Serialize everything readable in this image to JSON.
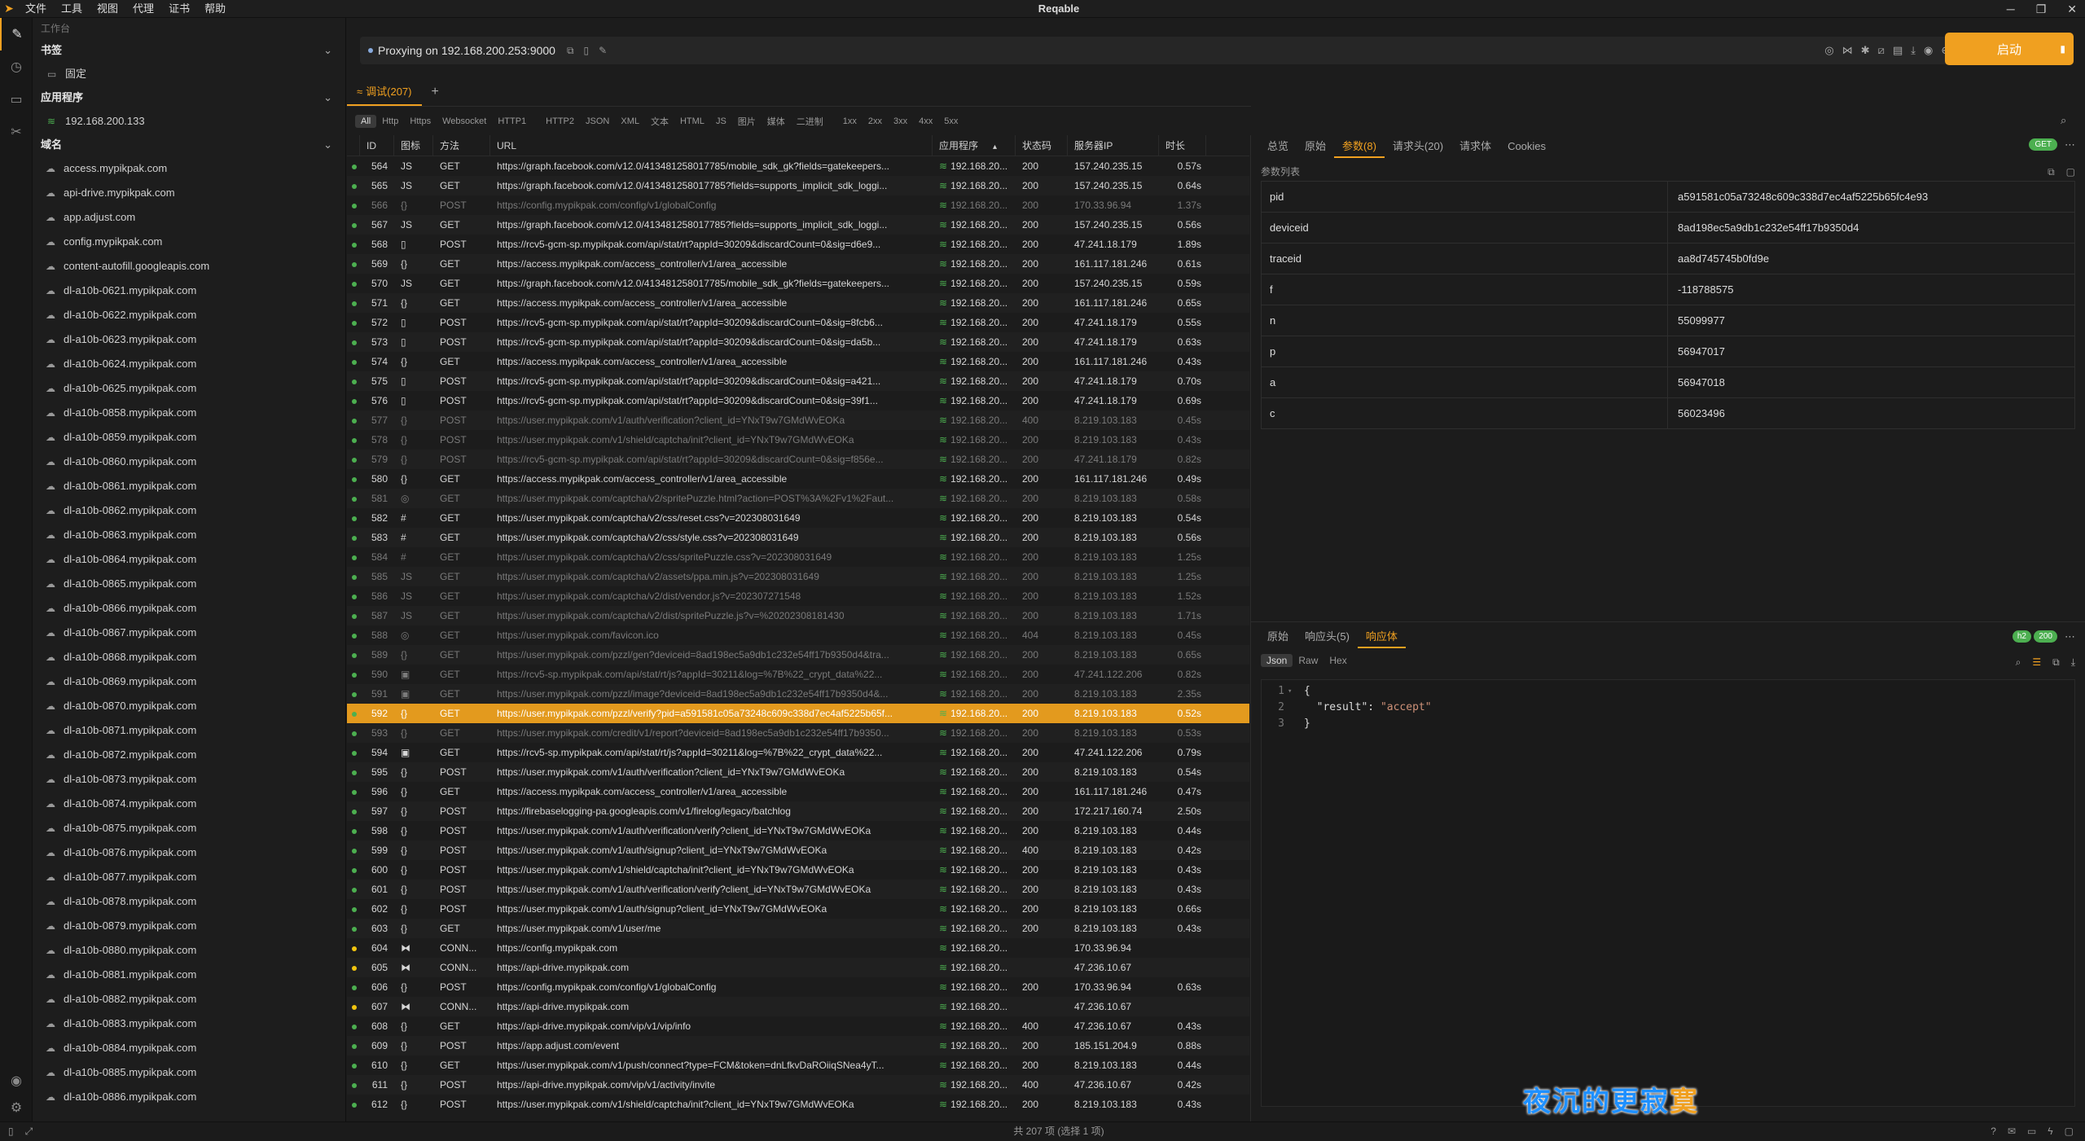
{
  "window": {
    "title": "Reqable",
    "menus": [
      "文件",
      "工具",
      "视图",
      "代理",
      "证书",
      "帮助"
    ]
  },
  "sidebar": {
    "header": "工作台",
    "bookmarks_label": "书签",
    "bookmarks": [
      {
        "label": "固定"
      }
    ],
    "apps_label": "应用程序",
    "apps": [
      {
        "label": "192.168.200.133"
      }
    ],
    "domains_label": "域名",
    "domains": [
      "access.mypikpak.com",
      "api-drive.mypikpak.com",
      "app.adjust.com",
      "config.mypikpak.com",
      "content-autofill.googleapis.com",
      "dl-a10b-0621.mypikpak.com",
      "dl-a10b-0622.mypikpak.com",
      "dl-a10b-0623.mypikpak.com",
      "dl-a10b-0624.mypikpak.com",
      "dl-a10b-0625.mypikpak.com",
      "dl-a10b-0858.mypikpak.com",
      "dl-a10b-0859.mypikpak.com",
      "dl-a10b-0860.mypikpak.com",
      "dl-a10b-0861.mypikpak.com",
      "dl-a10b-0862.mypikpak.com",
      "dl-a10b-0863.mypikpak.com",
      "dl-a10b-0864.mypikpak.com",
      "dl-a10b-0865.mypikpak.com",
      "dl-a10b-0866.mypikpak.com",
      "dl-a10b-0867.mypikpak.com",
      "dl-a10b-0868.mypikpak.com",
      "dl-a10b-0869.mypikpak.com",
      "dl-a10b-0870.mypikpak.com",
      "dl-a10b-0871.mypikpak.com",
      "dl-a10b-0872.mypikpak.com",
      "dl-a10b-0873.mypikpak.com",
      "dl-a10b-0874.mypikpak.com",
      "dl-a10b-0875.mypikpak.com",
      "dl-a10b-0876.mypikpak.com",
      "dl-a10b-0877.mypikpak.com",
      "dl-a10b-0878.mypikpak.com",
      "dl-a10b-0879.mypikpak.com",
      "dl-a10b-0880.mypikpak.com",
      "dl-a10b-0881.mypikpak.com",
      "dl-a10b-0882.mypikpak.com",
      "dl-a10b-0883.mypikpak.com",
      "dl-a10b-0884.mypikpak.com",
      "dl-a10b-0885.mypikpak.com",
      "dl-a10b-0886.mypikpak.com"
    ]
  },
  "proxy": {
    "text": "Proxying on 192.168.200.253:9000",
    "start_label": "启动"
  },
  "tabs": {
    "debug_label": "调试(207)",
    "add_label": "+"
  },
  "filters": [
    "All",
    "Http",
    "Https",
    "Websocket",
    "HTTP1",
    "HTTP2",
    "JSON",
    "XML",
    "文本",
    "HTML",
    "JS",
    "图片",
    "媒体",
    "二进制",
    "1xx",
    "2xx",
    "3xx",
    "4xx",
    "5xx"
  ],
  "table": {
    "headers": {
      "id": "ID",
      "icon": "图标",
      "method": "方法",
      "url": "URL",
      "app": "应用程序",
      "status": "状态码",
      "ip": "服务器IP",
      "duration": "时长"
    },
    "rows": [
      {
        "id": "564",
        "icon": "JS",
        "method": "GET",
        "url": "https://graph.facebook.com/v12.0/413481258017785/mobile_sdk_gk?fields=gatekeepers...",
        "app": "192.168.20...",
        "status": "200",
        "ip": "157.240.235.15",
        "dur": "0.57s",
        "dot": "green",
        "dim": false
      },
      {
        "id": "565",
        "icon": "JS",
        "method": "GET",
        "url": "https://graph.facebook.com/v12.0/413481258017785?fields=supports_implicit_sdk_loggi...",
        "app": "192.168.20...",
        "status": "200",
        "ip": "157.240.235.15",
        "dur": "0.64s",
        "dot": "green",
        "dim": false
      },
      {
        "id": "566",
        "icon": "{}",
        "method": "POST",
        "url": "https://config.mypikpak.com/config/v1/globalConfig",
        "app": "192.168.20...",
        "status": "200",
        "ip": "170.33.96.94",
        "dur": "1.37s",
        "dot": "green",
        "dim": true
      },
      {
        "id": "567",
        "icon": "JS",
        "method": "GET",
        "url": "https://graph.facebook.com/v12.0/413481258017785?fields=supports_implicit_sdk_loggi...",
        "app": "192.168.20...",
        "status": "200",
        "ip": "157.240.235.15",
        "dur": "0.56s",
        "dot": "green",
        "dim": false
      },
      {
        "id": "568",
        "icon": "▯",
        "method": "POST",
        "url": "https://rcv5-gcm-sp.mypikpak.com/api/stat/rt?appId=30209&discardCount=0&sig=d6e9...",
        "app": "192.168.20...",
        "status": "200",
        "ip": "47.241.18.179",
        "dur": "1.89s",
        "dot": "green",
        "dim": false
      },
      {
        "id": "569",
        "icon": "{}",
        "method": "GET",
        "url": "https://access.mypikpak.com/access_controller/v1/area_accessible",
        "app": "192.168.20...",
        "status": "200",
        "ip": "161.117.181.246",
        "dur": "0.61s",
        "dot": "green",
        "dim": false
      },
      {
        "id": "570",
        "icon": "JS",
        "method": "GET",
        "url": "https://graph.facebook.com/v12.0/413481258017785/mobile_sdk_gk?fields=gatekeepers...",
        "app": "192.168.20...",
        "status": "200",
        "ip": "157.240.235.15",
        "dur": "0.59s",
        "dot": "green",
        "dim": false
      },
      {
        "id": "571",
        "icon": "{}",
        "method": "GET",
        "url": "https://access.mypikpak.com/access_controller/v1/area_accessible",
        "app": "192.168.20...",
        "status": "200",
        "ip": "161.117.181.246",
        "dur": "0.65s",
        "dot": "green",
        "dim": false
      },
      {
        "id": "572",
        "icon": "▯",
        "method": "POST",
        "url": "https://rcv5-gcm-sp.mypikpak.com/api/stat/rt?appId=30209&discardCount=0&sig=8fcb6...",
        "app": "192.168.20...",
        "status": "200",
        "ip": "47.241.18.179",
        "dur": "0.55s",
        "dot": "green",
        "dim": false
      },
      {
        "id": "573",
        "icon": "▯",
        "method": "POST",
        "url": "https://rcv5-gcm-sp.mypikpak.com/api/stat/rt?appId=30209&discardCount=0&sig=da5b...",
        "app": "192.168.20...",
        "status": "200",
        "ip": "47.241.18.179",
        "dur": "0.63s",
        "dot": "green",
        "dim": false
      },
      {
        "id": "574",
        "icon": "{}",
        "method": "GET",
        "url": "https://access.mypikpak.com/access_controller/v1/area_accessible",
        "app": "192.168.20...",
        "status": "200",
        "ip": "161.117.181.246",
        "dur": "0.43s",
        "dot": "green",
        "dim": false
      },
      {
        "id": "575",
        "icon": "▯",
        "method": "POST",
        "url": "https://rcv5-gcm-sp.mypikpak.com/api/stat/rt?appId=30209&discardCount=0&sig=a421...",
        "app": "192.168.20...",
        "status": "200",
        "ip": "47.241.18.179",
        "dur": "0.70s",
        "dot": "green",
        "dim": false
      },
      {
        "id": "576",
        "icon": "▯",
        "method": "POST",
        "url": "https://rcv5-gcm-sp.mypikpak.com/api/stat/rt?appId=30209&discardCount=0&sig=39f1...",
        "app": "192.168.20...",
        "status": "200",
        "ip": "47.241.18.179",
        "dur": "0.69s",
        "dot": "green",
        "dim": false
      },
      {
        "id": "577",
        "icon": "{}",
        "method": "POST",
        "url": "https://user.mypikpak.com/v1/auth/verification?client_id=YNxT9w7GMdWvEOKa",
        "app": "192.168.20...",
        "status": "400",
        "ip": "8.219.103.183",
        "dur": "0.45s",
        "dot": "green",
        "dim": true
      },
      {
        "id": "578",
        "icon": "{}",
        "method": "POST",
        "url": "https://user.mypikpak.com/v1/shield/captcha/init?client_id=YNxT9w7GMdWvEOKa",
        "app": "192.168.20...",
        "status": "200",
        "ip": "8.219.103.183",
        "dur": "0.43s",
        "dot": "green",
        "dim": true
      },
      {
        "id": "579",
        "icon": "{}",
        "method": "POST",
        "url": "https://rcv5-gcm-sp.mypikpak.com/api/stat/rt?appId=30209&discardCount=0&sig=f856e...",
        "app": "192.168.20...",
        "status": "200",
        "ip": "47.241.18.179",
        "dur": "0.82s",
        "dot": "green",
        "dim": true
      },
      {
        "id": "580",
        "icon": "{}",
        "method": "GET",
        "url": "https://access.mypikpak.com/access_controller/v1/area_accessible",
        "app": "192.168.20...",
        "status": "200",
        "ip": "161.117.181.246",
        "dur": "0.49s",
        "dot": "green",
        "dim": false
      },
      {
        "id": "581",
        "icon": "◎",
        "method": "GET",
        "url": "https://user.mypikpak.com/captcha/v2/spritePuzzle.html?action=POST%3A%2Fv1%2Faut...",
        "app": "192.168.20...",
        "status": "200",
        "ip": "8.219.103.183",
        "dur": "0.58s",
        "dot": "green",
        "dim": true
      },
      {
        "id": "582",
        "icon": "#",
        "method": "GET",
        "url": "https://user.mypikpak.com/captcha/v2/css/reset.css?v=202308031649",
        "app": "192.168.20...",
        "status": "200",
        "ip": "8.219.103.183",
        "dur": "0.54s",
        "dot": "green",
        "dim": false
      },
      {
        "id": "583",
        "icon": "#",
        "method": "GET",
        "url": "https://user.mypikpak.com/captcha/v2/css/style.css?v=202308031649",
        "app": "192.168.20...",
        "status": "200",
        "ip": "8.219.103.183",
        "dur": "0.56s",
        "dot": "green",
        "dim": false
      },
      {
        "id": "584",
        "icon": "#",
        "method": "GET",
        "url": "https://user.mypikpak.com/captcha/v2/css/spritePuzzle.css?v=202308031649",
        "app": "192.168.20...",
        "status": "200",
        "ip": "8.219.103.183",
        "dur": "1.25s",
        "dot": "green",
        "dim": true
      },
      {
        "id": "585",
        "icon": "JS",
        "method": "GET",
        "url": "https://user.mypikpak.com/captcha/v2/assets/ppa.min.js?v=202308031649",
        "app": "192.168.20...",
        "status": "200",
        "ip": "8.219.103.183",
        "dur": "1.25s",
        "dot": "green",
        "dim": true
      },
      {
        "id": "586",
        "icon": "JS",
        "method": "GET",
        "url": "https://user.mypikpak.com/captcha/v2/dist/vendor.js?v=202307271548",
        "app": "192.168.20...",
        "status": "200",
        "ip": "8.219.103.183",
        "dur": "1.52s",
        "dot": "green",
        "dim": true
      },
      {
        "id": "587",
        "icon": "JS",
        "method": "GET",
        "url": "https://user.mypikpak.com/captcha/v2/dist/spritePuzzle.js?v=%20202308181430",
        "app": "192.168.20...",
        "status": "200",
        "ip": "8.219.103.183",
        "dur": "1.71s",
        "dot": "green",
        "dim": true
      },
      {
        "id": "588",
        "icon": "◎",
        "method": "GET",
        "url": "https://user.mypikpak.com/favicon.ico",
        "app": "192.168.20...",
        "status": "404",
        "ip": "8.219.103.183",
        "dur": "0.45s",
        "dot": "green",
        "dim": true
      },
      {
        "id": "589",
        "icon": "{}",
        "method": "GET",
        "url": "https://user.mypikpak.com/pzzl/gen?deviceid=8ad198ec5a9db1c232e54ff17b9350d4&tra...",
        "app": "192.168.20...",
        "status": "200",
        "ip": "8.219.103.183",
        "dur": "0.65s",
        "dot": "green",
        "dim": true
      },
      {
        "id": "590",
        "icon": "▣",
        "method": "GET",
        "url": "https://rcv5-sp.mypikpak.com/api/stat/rt/js?appId=30211&log=%7B%22_crypt_data%22...",
        "app": "192.168.20...",
        "status": "200",
        "ip": "47.241.122.206",
        "dur": "0.82s",
        "dot": "green",
        "dim": true
      },
      {
        "id": "591",
        "icon": "▣",
        "method": "GET",
        "url": "https://user.mypikpak.com/pzzl/image?deviceid=8ad198ec5a9db1c232e54ff17b9350d4&...",
        "app": "192.168.20...",
        "status": "200",
        "ip": "8.219.103.183",
        "dur": "2.35s",
        "dot": "green",
        "dim": true
      },
      {
        "id": "592",
        "icon": "{}",
        "method": "GET",
        "url": "https://user.mypikpak.com/pzzl/verify?pid=a591581c05a73248c609c338d7ec4af5225b65f...",
        "app": "192.168.20...",
        "status": "200",
        "ip": "8.219.103.183",
        "dur": "0.52s",
        "dot": "green",
        "dim": false,
        "selected": true
      },
      {
        "id": "593",
        "icon": "{}",
        "method": "GET",
        "url": "https://user.mypikpak.com/credit/v1/report?deviceid=8ad198ec5a9db1c232e54ff17b9350...",
        "app": "192.168.20...",
        "status": "200",
        "ip": "8.219.103.183",
        "dur": "0.53s",
        "dot": "green",
        "dim": true
      },
      {
        "id": "594",
        "icon": "▣",
        "method": "GET",
        "url": "https://rcv5-sp.mypikpak.com/api/stat/rt/js?appId=30211&log=%7B%22_crypt_data%22...",
        "app": "192.168.20...",
        "status": "200",
        "ip": "47.241.122.206",
        "dur": "0.79s",
        "dot": "green",
        "dim": false
      },
      {
        "id": "595",
        "icon": "{}",
        "method": "POST",
        "url": "https://user.mypikpak.com/v1/auth/verification?client_id=YNxT9w7GMdWvEOKa",
        "app": "192.168.20...",
        "status": "200",
        "ip": "8.219.103.183",
        "dur": "0.54s",
        "dot": "green",
        "dim": false
      },
      {
        "id": "596",
        "icon": "{}",
        "method": "GET",
        "url": "https://access.mypikpak.com/access_controller/v1/area_accessible",
        "app": "192.168.20...",
        "status": "200",
        "ip": "161.117.181.246",
        "dur": "0.47s",
        "dot": "green",
        "dim": false
      },
      {
        "id": "597",
        "icon": "{}",
        "method": "POST",
        "url": "https://firebaselogging-pa.googleapis.com/v1/firelog/legacy/batchlog",
        "app": "192.168.20...",
        "status": "200",
        "ip": "172.217.160.74",
        "dur": "2.50s",
        "dot": "green",
        "dim": false
      },
      {
        "id": "598",
        "icon": "{}",
        "method": "POST",
        "url": "https://user.mypikpak.com/v1/auth/verification/verify?client_id=YNxT9w7GMdWvEOKa",
        "app": "192.168.20...",
        "status": "200",
        "ip": "8.219.103.183",
        "dur": "0.44s",
        "dot": "green",
        "dim": false
      },
      {
        "id": "599",
        "icon": "{}",
        "method": "POST",
        "url": "https://user.mypikpak.com/v1/auth/signup?client_id=YNxT9w7GMdWvEOKa",
        "app": "192.168.20...",
        "status": "400",
        "ip": "8.219.103.183",
        "dur": "0.42s",
        "dot": "green",
        "dim": false
      },
      {
        "id": "600",
        "icon": "{}",
        "method": "POST",
        "url": "https://user.mypikpak.com/v1/shield/captcha/init?client_id=YNxT9w7GMdWvEOKa",
        "app": "192.168.20...",
        "status": "200",
        "ip": "8.219.103.183",
        "dur": "0.43s",
        "dot": "green",
        "dim": false
      },
      {
        "id": "601",
        "icon": "{}",
        "method": "POST",
        "url": "https://user.mypikpak.com/v1/auth/verification/verify?client_id=YNxT9w7GMdWvEOKa",
        "app": "192.168.20...",
        "status": "200",
        "ip": "8.219.103.183",
        "dur": "0.43s",
        "dot": "green",
        "dim": false
      },
      {
        "id": "602",
        "icon": "{}",
        "method": "POST",
        "url": "https://user.mypikpak.com/v1/auth/signup?client_id=YNxT9w7GMdWvEOKa",
        "app": "192.168.20...",
        "status": "200",
        "ip": "8.219.103.183",
        "dur": "0.66s",
        "dot": "green",
        "dim": false
      },
      {
        "id": "603",
        "icon": "{}",
        "method": "GET",
        "url": "https://user.mypikpak.com/v1/user/me",
        "app": "192.168.20...",
        "status": "200",
        "ip": "8.219.103.183",
        "dur": "0.43s",
        "dot": "green",
        "dim": false
      },
      {
        "id": "604",
        "icon": "⧓",
        "method": "CONN...",
        "url": "https://config.mypikpak.com",
        "app": "192.168.20...",
        "status": "",
        "ip": "170.33.96.94",
        "dur": "",
        "dot": "yellow",
        "dim": false
      },
      {
        "id": "605",
        "icon": "⧓",
        "method": "CONN...",
        "url": "https://api-drive.mypikpak.com",
        "app": "192.168.20...",
        "status": "",
        "ip": "47.236.10.67",
        "dur": "",
        "dot": "yellow",
        "dim": false
      },
      {
        "id": "606",
        "icon": "{}",
        "method": "POST",
        "url": "https://config.mypikpak.com/config/v1/globalConfig",
        "app": "192.168.20...",
        "status": "200",
        "ip": "170.33.96.94",
        "dur": "0.63s",
        "dot": "green",
        "dim": false
      },
      {
        "id": "607",
        "icon": "⧓",
        "method": "CONN...",
        "url": "https://api-drive.mypikpak.com",
        "app": "192.168.20...",
        "status": "",
        "ip": "47.236.10.67",
        "dur": "",
        "dot": "yellow",
        "dim": false
      },
      {
        "id": "608",
        "icon": "{}",
        "method": "GET",
        "url": "https://api-drive.mypikpak.com/vip/v1/vip/info",
        "app": "192.168.20...",
        "status": "400",
        "ip": "47.236.10.67",
        "dur": "0.43s",
        "dot": "green",
        "dim": false
      },
      {
        "id": "609",
        "icon": "{}",
        "method": "POST",
        "url": "https://app.adjust.com/event",
        "app": "192.168.20...",
        "status": "200",
        "ip": "185.151.204.9",
        "dur": "0.88s",
        "dot": "green",
        "dim": false
      },
      {
        "id": "610",
        "icon": "{}",
        "method": "GET",
        "url": "https://user.mypikpak.com/v1/push/connect?type=FCM&token=dnLfkvDaROiiqSNea4yT...",
        "app": "192.168.20...",
        "status": "200",
        "ip": "8.219.103.183",
        "dur": "0.44s",
        "dot": "green",
        "dim": false
      },
      {
        "id": "611",
        "icon": "{}",
        "method": "POST",
        "url": "https://api-drive.mypikpak.com/vip/v1/activity/invite",
        "app": "192.168.20...",
        "status": "400",
        "ip": "47.236.10.67",
        "dur": "0.42s",
        "dot": "green",
        "dim": false
      },
      {
        "id": "612",
        "icon": "{}",
        "method": "POST",
        "url": "https://user.mypikpak.com/v1/shield/captcha/init?client_id=YNxT9w7GMdWvEOKa",
        "app": "192.168.20...",
        "status": "200",
        "ip": "8.219.103.183",
        "dur": "0.43s",
        "dot": "green",
        "dim": false
      }
    ]
  },
  "detail": {
    "tabs": [
      "总览",
      "原始",
      "参数(8)",
      "请求头(20)",
      "请求体",
      "Cookies"
    ],
    "method_badge": "GET",
    "param_title": "参数列表",
    "params": [
      {
        "k": "pid",
        "v": "a591581c05a73248c609c338d7ec4af5225b65fc4e93"
      },
      {
        "k": "deviceid",
        "v": "8ad198ec5a9db1c232e54ff17b9350d4"
      },
      {
        "k": "traceid",
        "v": "aa8d745745b0fd9e"
      },
      {
        "k": "f",
        "v": "-118788575"
      },
      {
        "k": "n",
        "v": "55099977"
      },
      {
        "k": "p",
        "v": "56947017"
      },
      {
        "k": "a",
        "v": "56947018"
      },
      {
        "k": "c",
        "v": "56023496"
      }
    ]
  },
  "response": {
    "tabs": [
      "原始",
      "响应头(5)",
      "响应体"
    ],
    "proto_badge": "h2",
    "status_badge": "200",
    "formats": [
      "Json",
      "Raw",
      "Hex"
    ],
    "lines": [
      {
        "n": "1",
        "t": "{"
      },
      {
        "n": "2",
        "k": "\"result\"",
        "s": "\"accept\""
      },
      {
        "n": "3",
        "t": "}"
      }
    ]
  },
  "watermark": {
    "main": "夜沉的更寂",
    "last": "寞"
  },
  "status": {
    "text": "共 207 项 (选择 1 项)"
  }
}
